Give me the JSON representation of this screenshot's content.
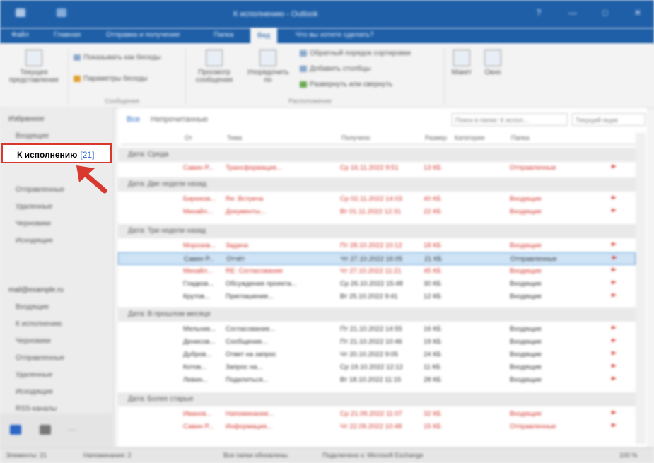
{
  "colors": {
    "accent": "#1e5fa8",
    "highlight": "#d9382e",
    "unread": "#d2342b",
    "selected": "#cfe3f6"
  },
  "window": {
    "title": "К исполнению - Outlook",
    "controls": [
      "?",
      "—",
      "□",
      "✕"
    ]
  },
  "ribbon": {
    "tabs": [
      "Файл",
      "Главная",
      "Отправка и получение",
      "Папка",
      "Вид",
      "Что вы хотите сделать?"
    ],
    "buttons": {
      "current_view": "Текущее представление",
      "show_conversations": "Показывать как беседы",
      "conversation_settings": "Параметры беседы",
      "view_messages": "Просмотр сообщения",
      "arrange_by": "Упорядочить по",
      "reverse_sort": "Обратный порядок сортировки",
      "add_columns": "Добавить столбцы",
      "expand_collapse": "Развернуть или свернуть",
      "layout": "Макет",
      "window": "Окно"
    },
    "groups": [
      "Сообщения",
      "Расположение"
    ]
  },
  "nav": {
    "favorites": "Избранное",
    "items_fav": [
      {
        "label": "Входящие",
        "count": ""
      },
      {
        "label": "Отправленные",
        "count": ""
      },
      {
        "label": "Удаленные",
        "count": ""
      },
      {
        "label": "Черновики",
        "count": ""
      },
      {
        "label": "Исходящие",
        "count": ""
      }
    ],
    "focus_item": {
      "label": "К исполнению",
      "count": "[21]"
    },
    "account": "mail@example.ru",
    "items_acc": [
      {
        "label": "Входящие",
        "count": ""
      },
      {
        "label": "К исполнению",
        "count": ""
      },
      {
        "label": "Черновики",
        "count": ""
      },
      {
        "label": "Отправленные",
        "count": ""
      },
      {
        "label": "Удаленные",
        "count": ""
      },
      {
        "label": "Исходящие",
        "count": ""
      },
      {
        "label": "RSS-каналы",
        "count": ""
      }
    ]
  },
  "list": {
    "filters": [
      "Все",
      "Непрочитанные"
    ],
    "search_placeholder": "Поиск в папке: К испол...",
    "mailbox_selector": "Текущий ящик",
    "columns": [
      "От",
      "Тема",
      "Получено",
      "Размер",
      "Категории",
      "Папка"
    ],
    "groups": [
      {
        "label": "Дата: Среда",
        "rows": [
          {
            "from": "Савин Р...",
            "subject": "Трансформация...",
            "received": "Ср 16.11.2022 9:51",
            "size": "13 КБ",
            "folder": "Отправленные",
            "unread": true,
            "flag": "red"
          }
        ]
      },
      {
        "label": "Дата: Две недели назад",
        "rows": [
          {
            "from": "Бирюков...",
            "subject": "Re: Встреча",
            "received": "Ср 02.11.2022 14:03",
            "size": "40 КБ",
            "folder": "Входящие",
            "unread": true,
            "flag": "red"
          },
          {
            "from": "Михайл...",
            "subject": "Документы...",
            "received": "Вт 01.11.2022 12:31",
            "size": "22 КБ",
            "folder": "Входящие",
            "unread": true,
            "flag": "red"
          }
        ]
      },
      {
        "label": "Дата: Три недели назад",
        "rows": [
          {
            "from": "Морозов...",
            "subject": "Задача",
            "received": "Пт 28.10.2022 10:12",
            "size": "18 КБ",
            "folder": "Входящие",
            "unread": true,
            "flag": "red"
          },
          {
            "from": "Савин Р...",
            "subject": "Отчёт",
            "received": "Чт 27.10.2022 16:05",
            "size": "21 КБ",
            "folder": "Отправленные",
            "unread": false,
            "flag": "red",
            "selected": true
          },
          {
            "from": "Михайл...",
            "subject": "RE: Согласование",
            "received": "Чт 27.10.2022 11:21",
            "size": "45 КБ",
            "folder": "Входящие",
            "unread": true,
            "flag": "red"
          },
          {
            "from": "Гладков...",
            "subject": "Обсуждение проекта...",
            "received": "Ср 26.10.2022 15:48",
            "size": "30 КБ",
            "folder": "Входящие",
            "unread": false,
            "flag": "red"
          },
          {
            "from": "Крутов...",
            "subject": "Приглашение...",
            "received": "Вт 25.10.2022 9:41",
            "size": "12 КБ",
            "folder": "Входящие",
            "unread": false,
            "flag": "red"
          }
        ]
      },
      {
        "label": "Дата: В прошлом месяце",
        "rows": [
          {
            "from": "Мельник...",
            "subject": "Согласование...",
            "received": "Пт 21.10.2022 14:55",
            "size": "16 КБ",
            "folder": "Входящие",
            "unread": false,
            "flag": "red"
          },
          {
            "from": "Денисов...",
            "subject": "Сообщение...",
            "received": "Пт 21.10.2022 10:46",
            "size": "19 КБ",
            "folder": "Входящие",
            "unread": false,
            "flag": "red"
          },
          {
            "from": "Дубров...",
            "subject": "Ответ на запрос",
            "received": "Чт 20.10.2022 9:05",
            "size": "24 КБ",
            "folder": "Входящие",
            "unread": false,
            "flag": "red"
          },
          {
            "from": "Котов...",
            "subject": "Запрос на...",
            "received": "Ср 19.10.2022 12:12",
            "size": "11 КБ",
            "folder": "Входящие",
            "unread": false,
            "flag": "red"
          },
          {
            "from": "Левин...",
            "subject": "Поделиться...",
            "received": "Вт 18.10.2022 11:15",
            "size": "28 КБ",
            "folder": "Входящие",
            "unread": false,
            "flag": "red"
          }
        ]
      },
      {
        "label": "Дата: Более старые",
        "rows": [
          {
            "from": "Иванов...",
            "subject": "Напоминание...",
            "received": "Ср 21.09.2022 11:07",
            "size": "32 КБ",
            "folder": "Входящие",
            "unread": true,
            "flag": "red"
          },
          {
            "from": "Савин Р...",
            "subject": "Информация...",
            "received": "Чт 22.09.2022 10:48",
            "size": "15 КБ",
            "folder": "Отправленные",
            "unread": true,
            "flag": "red"
          }
        ]
      }
    ]
  },
  "status": {
    "left": [
      "Элементы: 21",
      "Напоминания: 2"
    ],
    "center": [
      "Все папки обновлены.",
      "Подключено к: Microsoft Exchange"
    ],
    "zoom": "100 %"
  }
}
